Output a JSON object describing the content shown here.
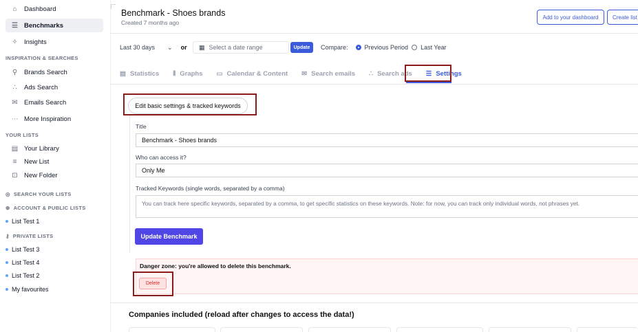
{
  "sidebar": {
    "nav": [
      {
        "label": "Dashboard",
        "icon": "home-icon"
      },
      {
        "label": "Benchmarks",
        "icon": "sliders-icon",
        "active": true
      },
      {
        "label": "Insights",
        "icon": "sparkle-icon"
      }
    ],
    "inspiration_header": "INSPIRATION & SEARCHES",
    "inspiration": [
      {
        "label": "Brands Search",
        "icon": "search-icon"
      },
      {
        "label": "Ads Search",
        "icon": "ad-icon"
      },
      {
        "label": "Emails Search",
        "icon": "envelope-icon"
      },
      {
        "label": "More Inspiration",
        "icon": "dots-icon"
      }
    ],
    "lists_header": "YOUR LISTS",
    "lists": [
      {
        "label": "Your Library",
        "icon": "library-icon"
      },
      {
        "label": "New List",
        "icon": "list-icon"
      },
      {
        "label": "New Folder",
        "icon": "folder-icon"
      }
    ],
    "search_lists": "SEARCH YOUR LISTS",
    "account_header": "ACCOUNT & PUBLIC LISTS",
    "account_lists": [
      "List Test 1"
    ],
    "private_header": "PRIVATE LISTS",
    "private_lists": [
      "List Test 3",
      "List Test 4",
      "List Test 2",
      "My favourites"
    ]
  },
  "header": {
    "title": "Benchmark - Shoes brands",
    "subtitle": "Created 7 months ago",
    "add_dashboard": "Add to your dashboard",
    "create_list": "Create list"
  },
  "filters": {
    "range": "Last 30 days",
    "or": "or",
    "date_placeholder": "Select a date range",
    "update": "Update",
    "compare": "Compare:",
    "option1": "Previous Period",
    "option2": "Last Year",
    "selected": "Previous Period"
  },
  "tabs": [
    {
      "label": "Statistics",
      "icon": "table-icon"
    },
    {
      "label": "Graphs",
      "icon": "bar-chart-icon"
    },
    {
      "label": "Calendar & Content",
      "icon": "calendar-icon"
    },
    {
      "label": "Search emails",
      "icon": "envelope-icon"
    },
    {
      "label": "Search ads",
      "icon": "ad-icon"
    },
    {
      "label": "Settings",
      "icon": "sliders-icon",
      "active": true
    }
  ],
  "settings": {
    "edit_button": "Edit basic settings & tracked keywords",
    "title_label": "Title",
    "title_value": "Benchmark - Shoes brands",
    "access_label": "Who can access it?",
    "access_value": "Only Me",
    "keywords_label": "Tracked Keywords (single words, separated by a comma)",
    "keywords_placeholder": "You can track here specific keywords, separated by a comma, to get specific statistics on these keywords.  Note: for now, you can track only individual words, not phrases yet.",
    "update_button": "Update Benchmark",
    "danger_text": "Danger zone: you're allowed to delete this benchmark.",
    "delete_button": "Delete"
  },
  "companies_title": "Companies included (reload after changes to access the data!)",
  "colors": {
    "accent": "#3b5bdb",
    "primary": "#4f46e5",
    "highlight": "#8b1a1a",
    "danger": "#dc2626"
  }
}
